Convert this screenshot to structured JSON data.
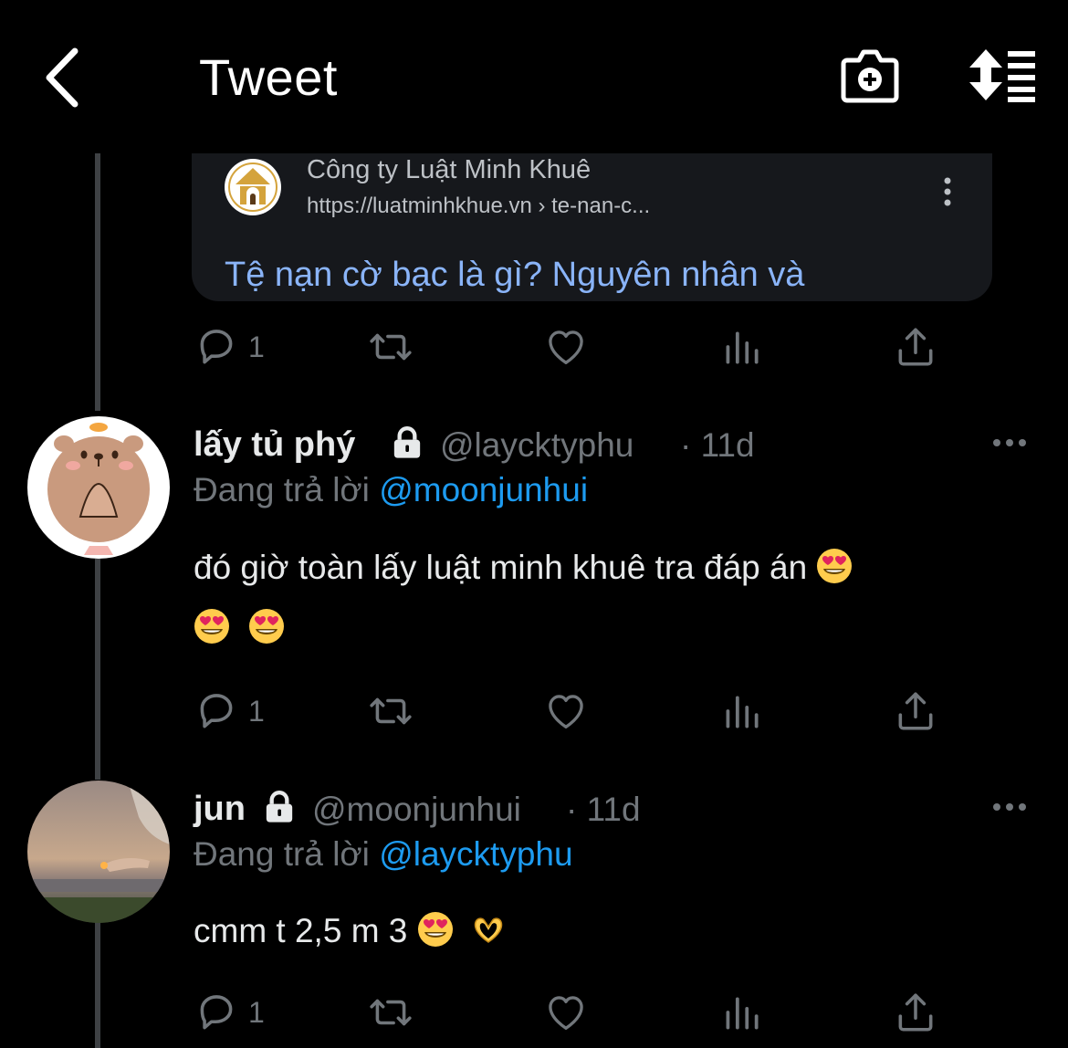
{
  "header": {
    "title": "Tweet"
  },
  "link_card": {
    "site_name": "Công ty Luật Minh Khuê",
    "url": "https://luatminhkhue.vn › te-nan-c...",
    "headline": "Tệ nạn cờ bạc là gì? Nguyên nhân và"
  },
  "tweet0_actions": {
    "reply_count": "1"
  },
  "tweets": [
    {
      "display_name": "lấy tủ phý",
      "handle": "@laycktyphu",
      "time": "· 11d",
      "replying_prefix": "Đang trả lời",
      "replying_to": "@moonjunhui",
      "text_line1": "đó giờ toàn lấy luật minh khuê tra đáp án",
      "reply_count": "1"
    },
    {
      "display_name": "jun",
      "handle": "@moonjunhui",
      "time": "· 11d",
      "replying_prefix": "Đang trả lời",
      "replying_to": "@laycktyphu",
      "text_line1": "cmm t 2,5 m 3",
      "reply_count": "1"
    }
  ],
  "colors": {
    "background": "#000000",
    "mention": "#1d9bf0",
    "muted": "#71767b",
    "link_headline": "#8ab4f8"
  },
  "icons": [
    "back-arrow-icon",
    "camera-plus-icon",
    "sort-icon",
    "more-vertical-icon",
    "reply-icon",
    "retweet-icon",
    "like-icon",
    "views-icon",
    "share-icon",
    "lock-icon",
    "more-horizontal-icon",
    "heart-eyes-emoji",
    "heart-hands-emoji"
  ]
}
